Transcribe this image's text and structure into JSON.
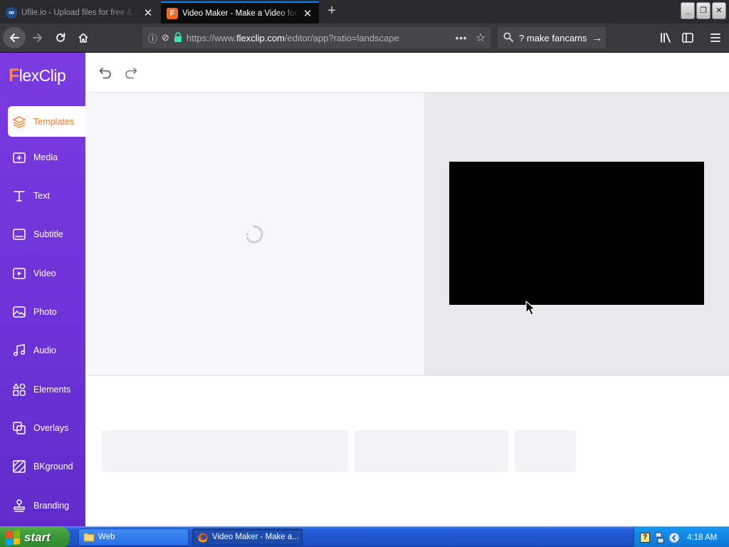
{
  "browser": {
    "tabs": [
      {
        "title": "Ufile.io - Upload files for free & share",
        "favicon": "ufile-icon",
        "active": false
      },
      {
        "title": "Video Maker - Make a Video for Free",
        "favicon": "flexclip-f-icon",
        "active": true
      }
    ],
    "url": {
      "prefix": "https://www.",
      "domain": "flexclip.com",
      "path": "/editor/app?ratio=landscape"
    },
    "search_text": "? make fancams"
  },
  "app": {
    "logo": {
      "first": "F",
      "rest": "lexClip"
    },
    "nav": [
      {
        "key": "templates",
        "label": "Templates",
        "icon": "templates-layers-icon",
        "active": true
      },
      {
        "key": "media",
        "label": "Media",
        "icon": "media-add-icon"
      },
      {
        "key": "text",
        "label": "Text",
        "icon": "text-t-icon"
      },
      {
        "key": "subtitle",
        "label": "Subtitle",
        "icon": "subtitle-icon"
      },
      {
        "key": "video",
        "label": "Video",
        "icon": "video-play-icon"
      },
      {
        "key": "photo",
        "label": "Photo",
        "icon": "photo-image-icon"
      },
      {
        "key": "audio",
        "label": "Audio",
        "icon": "audio-note-icon"
      },
      {
        "key": "elements",
        "label": "Elements",
        "icon": "elements-shapes-icon"
      },
      {
        "key": "overlays",
        "label": "Overlays",
        "icon": "overlays-icon"
      },
      {
        "key": "bkground",
        "label": "BKground",
        "icon": "background-icon"
      },
      {
        "key": "branding",
        "label": "Branding",
        "icon": "branding-stamp-icon"
      }
    ],
    "colors": {
      "sidebar": "#7a3ae0",
      "accent": "#ff7a2e",
      "canvas": "#000000"
    }
  },
  "taskbar": {
    "start_label": "start",
    "tasks": [
      {
        "label": "Web",
        "icon": "folder-icon"
      },
      {
        "label": "Video Maker - Make a...",
        "icon": "firefox-icon"
      }
    ],
    "clock": "4:18 AM"
  }
}
